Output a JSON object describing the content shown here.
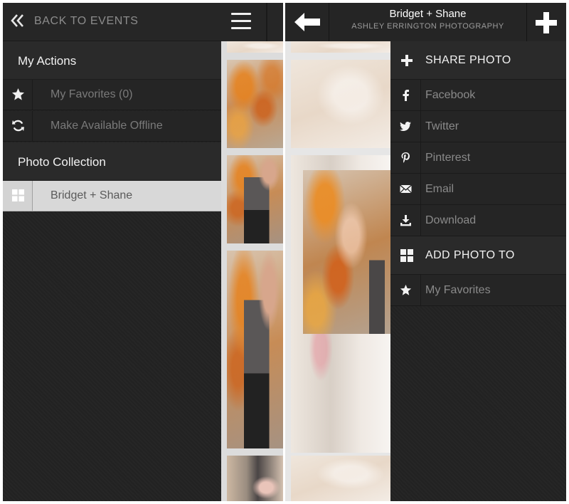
{
  "left_menu": {
    "back_label": "BACK TO EVENTS",
    "sections": [
      {
        "title": "My Actions"
      },
      {
        "title": "Photo Collection"
      }
    ],
    "items": [
      {
        "label": "My Favorites (0)",
        "icon": "star-icon"
      },
      {
        "label": "Make Available Offline",
        "icon": "refresh-icon"
      },
      {
        "label": "Bridget + Shane",
        "icon": "grid-icon",
        "selected": true
      }
    ]
  },
  "viewer": {
    "title": "Bridget + Shane",
    "subtitle": "ASHLEY ERRINGTON PHOTOGRAPHY"
  },
  "share_menu": {
    "share_heading": "SHARE PHOTO",
    "share_items": [
      {
        "label": "Facebook",
        "icon": "facebook-icon"
      },
      {
        "label": "Twitter",
        "icon": "twitter-icon"
      },
      {
        "label": "Pinterest",
        "icon": "pinterest-icon"
      },
      {
        "label": "Email",
        "icon": "email-icon"
      },
      {
        "label": "Download",
        "icon": "download-icon"
      }
    ],
    "add_heading": "ADD PHOTO TO",
    "add_items": [
      {
        "label": "My Favorites",
        "icon": "star-icon"
      }
    ]
  },
  "colors": {
    "menu_bg": "#232323",
    "header_bg": "#252525",
    "selected_row": "#d8d8d8",
    "primary_text": "#f2f2f2",
    "muted_text": "#8a8a8a"
  }
}
